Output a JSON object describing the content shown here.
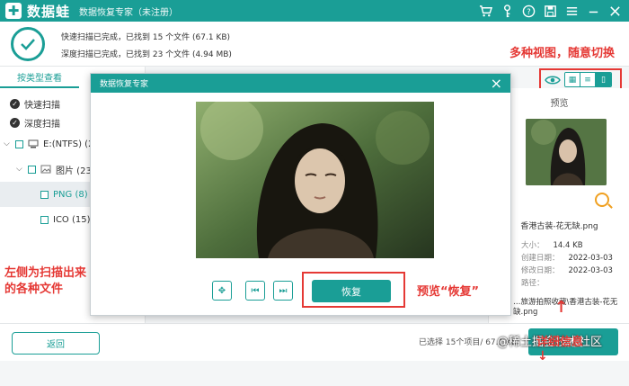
{
  "app": {
    "name": "数据蛙",
    "window_title": "数据恢复专家（未注册）",
    "accent": "#1a9e96",
    "annotation_color": "#e53935"
  },
  "titlebar_icons": [
    "cart-icon",
    "key-icon",
    "help-icon",
    "save-icon",
    "menu-icon",
    "minimize-icon",
    "close-icon"
  ],
  "scan": {
    "line1": "快速扫描已完成，已找到 15 个文件 (67.1 KB)",
    "line2": "深度扫描已完成，已找到 23 个文件 (4.94 MB)"
  },
  "sidebar": {
    "tab_label": "按类型查看",
    "quick_scan": "快速扫描",
    "deep_scan": "深度扫描",
    "drive": "E:(NTFS) (23)",
    "folder": "图片 (23)",
    "png": "PNG (8)",
    "ico": "ICO (15)"
  },
  "preview_panel": {
    "label": "预览",
    "filename": "香港古装-花无缺.png",
    "size_label": "大小：",
    "size_value": "14.4 KB",
    "created_label": "创建日期：",
    "created_value": "2022-03-03",
    "modified_label": "修改日期：",
    "modified_value": "2022-03-03",
    "path_label": "路径：",
    "path_value": "…旅游拍照收藏\\香港古装-花无缺.png"
  },
  "dialog": {
    "title": "数据恢复专家",
    "recover_label": "恢复"
  },
  "bottom": {
    "back_label": "返回",
    "selected_info": "已选择 15个项目/ 67.1 KB",
    "recover_label": "恢复"
  },
  "annotations": {
    "views": "多种视图，随意切换",
    "left_files": "左侧为扫描出来\n的各种文件",
    "preview_recover": "预览“恢复”",
    "details": "详细信息"
  },
  "watermark": "@稀土掘金技术社区"
}
